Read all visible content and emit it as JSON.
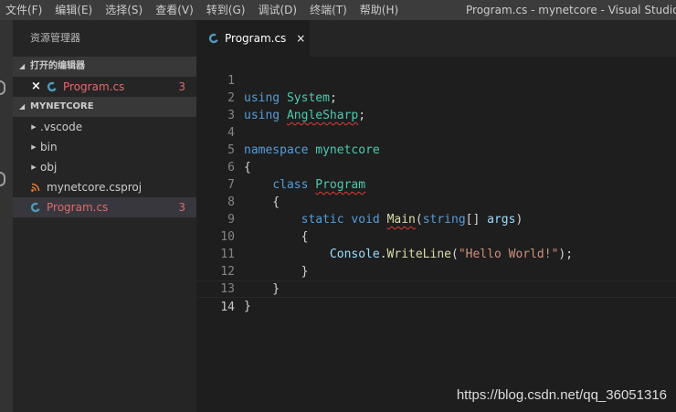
{
  "menubar": {
    "items": [
      "文件(F)",
      "编辑(E)",
      "选择(S)",
      "查看(V)",
      "转到(G)",
      "调试(D)",
      "终端(T)",
      "帮助(H)"
    ],
    "window_title": "Program.cs - mynetcore - Visual Studio Code"
  },
  "sidebar": {
    "title": "资源管理器",
    "open_editors": {
      "header": "打开的编辑器",
      "files": [
        {
          "name": "Program.cs",
          "problems": "3"
        }
      ]
    },
    "project": {
      "header": "MYNETCORE",
      "items": [
        {
          "name": ".vscode",
          "kind": "folder"
        },
        {
          "name": "bin",
          "kind": "folder"
        },
        {
          "name": "obj",
          "kind": "folder"
        },
        {
          "name": "mynetcore.csproj",
          "kind": "file"
        },
        {
          "name": "Program.cs",
          "kind": "file",
          "problems": "3"
        }
      ]
    }
  },
  "editor": {
    "tab": {
      "label": "Program.cs",
      "close": "×"
    },
    "line_numbers": [
      "1",
      "2",
      "3",
      "4",
      "5",
      "6",
      "7",
      "8",
      "9",
      "10",
      "11",
      "12",
      "13",
      "14"
    ],
    "current_line": "14",
    "code_lines": [
      "using System;",
      "using AngleSharp;",
      "",
      "namespace mynetcore",
      "{",
      "    class Program",
      "    {",
      "        static void Main(string[] args)",
      "        {",
      "            Console.WriteLine(\"Hello World!\");",
      "        }",
      "    }",
      "}",
      ""
    ]
  },
  "watermark": "https://blog.csdn.net/qq_36051316",
  "colors": {
    "keyword": "#569cd6",
    "type": "#4ec9b0",
    "function": "#dcdcaa",
    "string": "#ce9178",
    "error_text": "#e06c6c",
    "csharp_icon": "#519aba",
    "rss_icon": "#e37933"
  }
}
